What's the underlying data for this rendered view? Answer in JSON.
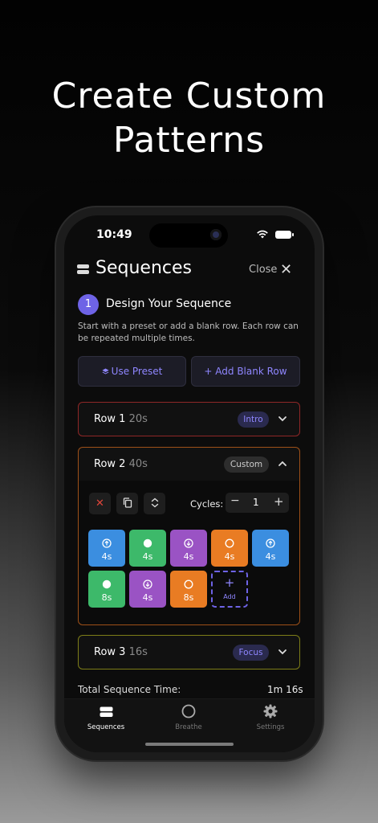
{
  "headline": {
    "line1": "Create Custom",
    "line2": "Patterns"
  },
  "status_bar": {
    "time": "10:49"
  },
  "header": {
    "title": "Sequences",
    "close_label": "Close"
  },
  "step": {
    "number": "1",
    "title": "Design Your Sequence",
    "description": "Start with a preset or add a blank row. Each row can be repeated multiple times."
  },
  "actions": {
    "use_preset": "Use Preset",
    "add_blank_row": "+ Add Blank Row"
  },
  "rows": [
    {
      "label": "Row 1",
      "duration": "20s",
      "tag": "Intro",
      "expanded": false,
      "border_color": "#8f2727"
    },
    {
      "label": "Row 2",
      "duration": "40s",
      "tag": "Custom",
      "expanded": true,
      "border_color": "#9e5018",
      "cycles_label": "Cycles:",
      "cycles": "1",
      "tiles": [
        {
          "kind": "inhale",
          "color": "blue",
          "seconds": "4s",
          "icon": "arrow-up-circle-icon"
        },
        {
          "kind": "hold",
          "color": "green",
          "seconds": "4s",
          "icon": "filled-circle-icon"
        },
        {
          "kind": "exhale",
          "color": "purple",
          "seconds": "4s",
          "icon": "arrow-down-circle-icon"
        },
        {
          "kind": "hold-empty",
          "color": "orange",
          "seconds": "4s",
          "icon": "empty-circle-icon"
        },
        {
          "kind": "inhale",
          "color": "blue",
          "seconds": "4s",
          "icon": "arrow-up-circle-icon"
        },
        {
          "kind": "hold",
          "color": "green",
          "seconds": "8s",
          "icon": "filled-circle-icon"
        },
        {
          "kind": "exhale",
          "color": "purple",
          "seconds": "4s",
          "icon": "arrow-down-circle-icon"
        },
        {
          "kind": "hold-empty",
          "color": "orange",
          "seconds": "8s",
          "icon": "empty-circle-icon"
        }
      ],
      "add_tile_label": "Add"
    },
    {
      "label": "Row 3",
      "duration": "16s",
      "tag": "Focus",
      "expanded": false,
      "border_color": "#7d7d18"
    }
  ],
  "total": {
    "label": "Total Sequence Time:",
    "value": "1m 16s"
  },
  "tabs": [
    {
      "label": "Sequences",
      "active": true,
      "icon": "stack-icon"
    },
    {
      "label": "Breathe",
      "active": false,
      "icon": "circle-icon"
    },
    {
      "label": "Settings",
      "active": false,
      "icon": "gear-icon"
    }
  ],
  "colors": {
    "accent": "#6e63e6",
    "accent_text": "#8f86ff",
    "blue": "#3b8ee0",
    "green": "#3db96a",
    "purple": "#9a53c4",
    "orange": "#e97c23",
    "delete": "#e0453a"
  }
}
